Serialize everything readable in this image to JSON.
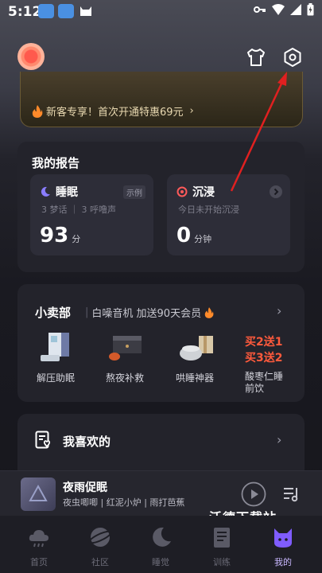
{
  "status_bar": {
    "time": "5:12"
  },
  "promo": {
    "text": "新客专享！首次开通特惠69元",
    "arrow": "›"
  },
  "report": {
    "title": "我的报告",
    "sleep": {
      "title": "睡眠",
      "badge": "示例",
      "subtitle": "3 梦话 ｜ 3 呼噜声",
      "value": "93",
      "unit": "分"
    },
    "immersion": {
      "title": "沉浸",
      "subtitle": "今日未开始沉浸",
      "value": "0",
      "unit": "分钟"
    }
  },
  "shop": {
    "title": "小卖部",
    "subtitle": "白噪音机 加送90天会员",
    "items": [
      {
        "label": "解压助眠"
      },
      {
        "label": "熬夜补救"
      },
      {
        "label": "哄睡神器"
      }
    ],
    "deal": {
      "line1": "买2送1",
      "line2": "买3送2",
      "label": "酸枣仁睡前饮"
    }
  },
  "favorites": {
    "title": "我喜欢的"
  },
  "player": {
    "title": "夜雨促眠",
    "subtitle": "夜虫唧唧 | 红泥小炉 | 雨打芭蕉"
  },
  "watermark": "沃德下载站",
  "tabs": [
    {
      "label": "首页",
      "icon": "home-cloud-icon"
    },
    {
      "label": "社区",
      "icon": "community-planet-icon"
    },
    {
      "label": "睡觉",
      "icon": "sleep-moon-icon"
    },
    {
      "label": "训练",
      "icon": "training-notebook-icon"
    },
    {
      "label": "我的",
      "icon": "profile-cat-icon",
      "active": true
    }
  ],
  "colors": {
    "accent": "#8a6cff",
    "deal": "#ff5a3c",
    "annotation": "#e02020"
  }
}
